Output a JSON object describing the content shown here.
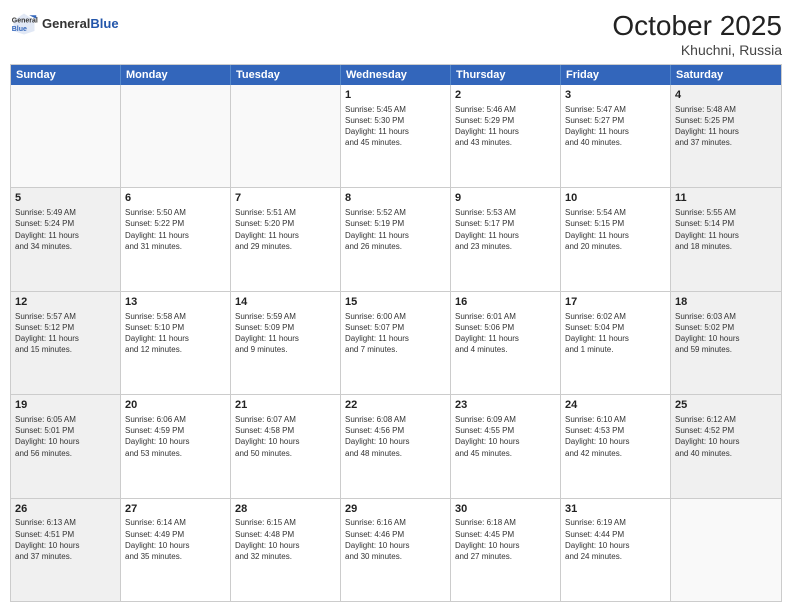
{
  "header": {
    "logo_general": "General",
    "logo_blue": "Blue",
    "month": "October 2025",
    "location": "Khuchni, Russia"
  },
  "days_of_week": [
    "Sunday",
    "Monday",
    "Tuesday",
    "Wednesday",
    "Thursday",
    "Friday",
    "Saturday"
  ],
  "rows": [
    [
      {
        "day": "",
        "text": "",
        "empty": true
      },
      {
        "day": "",
        "text": "",
        "empty": true
      },
      {
        "day": "",
        "text": "",
        "empty": true
      },
      {
        "day": "1",
        "text": "Sunrise: 5:45 AM\nSunset: 5:30 PM\nDaylight: 11 hours\nand 45 minutes.",
        "empty": false
      },
      {
        "day": "2",
        "text": "Sunrise: 5:46 AM\nSunset: 5:29 PM\nDaylight: 11 hours\nand 43 minutes.",
        "empty": false
      },
      {
        "day": "3",
        "text": "Sunrise: 5:47 AM\nSunset: 5:27 PM\nDaylight: 11 hours\nand 40 minutes.",
        "empty": false
      },
      {
        "day": "4",
        "text": "Sunrise: 5:48 AM\nSunset: 5:25 PM\nDaylight: 11 hours\nand 37 minutes.",
        "empty": false,
        "shaded": true
      }
    ],
    [
      {
        "day": "5",
        "text": "Sunrise: 5:49 AM\nSunset: 5:24 PM\nDaylight: 11 hours\nand 34 minutes.",
        "empty": false,
        "shaded": true
      },
      {
        "day": "6",
        "text": "Sunrise: 5:50 AM\nSunset: 5:22 PM\nDaylight: 11 hours\nand 31 minutes.",
        "empty": false
      },
      {
        "day": "7",
        "text": "Sunrise: 5:51 AM\nSunset: 5:20 PM\nDaylight: 11 hours\nand 29 minutes.",
        "empty": false
      },
      {
        "day": "8",
        "text": "Sunrise: 5:52 AM\nSunset: 5:19 PM\nDaylight: 11 hours\nand 26 minutes.",
        "empty": false
      },
      {
        "day": "9",
        "text": "Sunrise: 5:53 AM\nSunset: 5:17 PM\nDaylight: 11 hours\nand 23 minutes.",
        "empty": false
      },
      {
        "day": "10",
        "text": "Sunrise: 5:54 AM\nSunset: 5:15 PM\nDaylight: 11 hours\nand 20 minutes.",
        "empty": false
      },
      {
        "day": "11",
        "text": "Sunrise: 5:55 AM\nSunset: 5:14 PM\nDaylight: 11 hours\nand 18 minutes.",
        "empty": false,
        "shaded": true
      }
    ],
    [
      {
        "day": "12",
        "text": "Sunrise: 5:57 AM\nSunset: 5:12 PM\nDaylight: 11 hours\nand 15 minutes.",
        "empty": false,
        "shaded": true
      },
      {
        "day": "13",
        "text": "Sunrise: 5:58 AM\nSunset: 5:10 PM\nDaylight: 11 hours\nand 12 minutes.",
        "empty": false
      },
      {
        "day": "14",
        "text": "Sunrise: 5:59 AM\nSunset: 5:09 PM\nDaylight: 11 hours\nand 9 minutes.",
        "empty": false
      },
      {
        "day": "15",
        "text": "Sunrise: 6:00 AM\nSunset: 5:07 PM\nDaylight: 11 hours\nand 7 minutes.",
        "empty": false
      },
      {
        "day": "16",
        "text": "Sunrise: 6:01 AM\nSunset: 5:06 PM\nDaylight: 11 hours\nand 4 minutes.",
        "empty": false
      },
      {
        "day": "17",
        "text": "Sunrise: 6:02 AM\nSunset: 5:04 PM\nDaylight: 11 hours\nand 1 minute.",
        "empty": false
      },
      {
        "day": "18",
        "text": "Sunrise: 6:03 AM\nSunset: 5:02 PM\nDaylight: 10 hours\nand 59 minutes.",
        "empty": false,
        "shaded": true
      }
    ],
    [
      {
        "day": "19",
        "text": "Sunrise: 6:05 AM\nSunset: 5:01 PM\nDaylight: 10 hours\nand 56 minutes.",
        "empty": false,
        "shaded": true
      },
      {
        "day": "20",
        "text": "Sunrise: 6:06 AM\nSunset: 4:59 PM\nDaylight: 10 hours\nand 53 minutes.",
        "empty": false
      },
      {
        "day": "21",
        "text": "Sunrise: 6:07 AM\nSunset: 4:58 PM\nDaylight: 10 hours\nand 50 minutes.",
        "empty": false
      },
      {
        "day": "22",
        "text": "Sunrise: 6:08 AM\nSunset: 4:56 PM\nDaylight: 10 hours\nand 48 minutes.",
        "empty": false
      },
      {
        "day": "23",
        "text": "Sunrise: 6:09 AM\nSunset: 4:55 PM\nDaylight: 10 hours\nand 45 minutes.",
        "empty": false
      },
      {
        "day": "24",
        "text": "Sunrise: 6:10 AM\nSunset: 4:53 PM\nDaylight: 10 hours\nand 42 minutes.",
        "empty": false
      },
      {
        "day": "25",
        "text": "Sunrise: 6:12 AM\nSunset: 4:52 PM\nDaylight: 10 hours\nand 40 minutes.",
        "empty": false,
        "shaded": true
      }
    ],
    [
      {
        "day": "26",
        "text": "Sunrise: 6:13 AM\nSunset: 4:51 PM\nDaylight: 10 hours\nand 37 minutes.",
        "empty": false,
        "shaded": true
      },
      {
        "day": "27",
        "text": "Sunrise: 6:14 AM\nSunset: 4:49 PM\nDaylight: 10 hours\nand 35 minutes.",
        "empty": false
      },
      {
        "day": "28",
        "text": "Sunrise: 6:15 AM\nSunset: 4:48 PM\nDaylight: 10 hours\nand 32 minutes.",
        "empty": false
      },
      {
        "day": "29",
        "text": "Sunrise: 6:16 AM\nSunset: 4:46 PM\nDaylight: 10 hours\nand 30 minutes.",
        "empty": false
      },
      {
        "day": "30",
        "text": "Sunrise: 6:18 AM\nSunset: 4:45 PM\nDaylight: 10 hours\nand 27 minutes.",
        "empty": false
      },
      {
        "day": "31",
        "text": "Sunrise: 6:19 AM\nSunset: 4:44 PM\nDaylight: 10 hours\nand 24 minutes.",
        "empty": false
      },
      {
        "day": "",
        "text": "",
        "empty": true,
        "shaded": true
      }
    ]
  ]
}
